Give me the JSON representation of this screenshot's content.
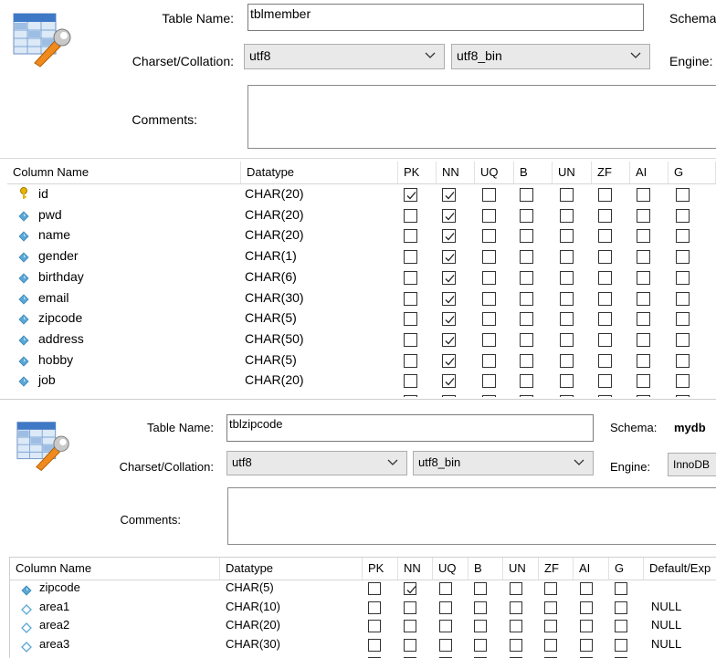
{
  "table1": {
    "table_name_label": "Table Name:",
    "table_name_value": "tblmember",
    "schema_label": "Schema",
    "charset_label": "Charset/Collation:",
    "charset_value": "utf8",
    "collation_value": "utf8_bin",
    "engine_label": "Engine:",
    "comments_label": "Comments:",
    "comments_value": "",
    "icon": "table-settings-icon",
    "columns_header": [
      "Column Name",
      "Datatype",
      "PK",
      "NN",
      "UQ",
      "B",
      "UN",
      "ZF",
      "AI",
      "G"
    ],
    "rows": [
      {
        "name": "id",
        "type": "CHAR(20)",
        "icon": "primary-key-icon",
        "pk": true,
        "nn": true
      },
      {
        "name": "pwd",
        "type": "CHAR(20)",
        "icon": "column-diamond-icon",
        "pk": false,
        "nn": true
      },
      {
        "name": "name",
        "type": "CHAR(20)",
        "icon": "column-diamond-icon",
        "pk": false,
        "nn": true
      },
      {
        "name": "gender",
        "type": "CHAR(1)",
        "icon": "column-diamond-icon",
        "pk": false,
        "nn": true
      },
      {
        "name": "birthday",
        "type": "CHAR(6)",
        "icon": "column-diamond-icon",
        "pk": false,
        "nn": true
      },
      {
        "name": "email",
        "type": "CHAR(30)",
        "icon": "column-diamond-icon",
        "pk": false,
        "nn": true
      },
      {
        "name": "zipcode",
        "type": "CHAR(5)",
        "icon": "column-diamond-icon",
        "pk": false,
        "nn": true
      },
      {
        "name": "address",
        "type": "CHAR(50)",
        "icon": "column-diamond-icon",
        "pk": false,
        "nn": true
      },
      {
        "name": "hobby",
        "type": "CHAR(5)",
        "icon": "column-diamond-icon",
        "pk": false,
        "nn": true
      },
      {
        "name": "job",
        "type": "CHAR(20)",
        "icon": "column-diamond-icon",
        "pk": false,
        "nn": true
      }
    ]
  },
  "table2": {
    "table_name_label": "Table Name:",
    "table_name_value": "tblzipcode",
    "schema_label": "Schema:",
    "schema_value": "mydb",
    "charset_label": "Charset/Collation:",
    "charset_value": "utf8",
    "collation_value": "utf8_bin",
    "engine_label": "Engine:",
    "engine_value": "InnoDB",
    "comments_label": "Comments:",
    "comments_value": "",
    "icon": "table-settings-icon",
    "columns_header": [
      "Column Name",
      "Datatype",
      "PK",
      "NN",
      "UQ",
      "B",
      "UN",
      "ZF",
      "AI",
      "G",
      "Default/Exp"
    ],
    "rows": [
      {
        "name": "zipcode",
        "type": "CHAR(5)",
        "icon": "column-diamond-filled-icon",
        "pk": false,
        "nn": true,
        "default": ""
      },
      {
        "name": "area1",
        "type": "CHAR(10)",
        "icon": "column-diamond-outline-icon",
        "pk": false,
        "nn": false,
        "default": "NULL"
      },
      {
        "name": "area2",
        "type": "CHAR(20)",
        "icon": "column-diamond-outline-icon",
        "pk": false,
        "nn": false,
        "default": "NULL"
      },
      {
        "name": "area3",
        "type": "CHAR(30)",
        "icon": "column-diamond-outline-icon",
        "pk": false,
        "nn": false,
        "default": "NULL"
      }
    ]
  },
  "colors": {
    "diamond": "#5aa7d6",
    "key": "#e8b400",
    "field_bg": "#ffffff",
    "combo_bg": "#e9e9e9"
  }
}
